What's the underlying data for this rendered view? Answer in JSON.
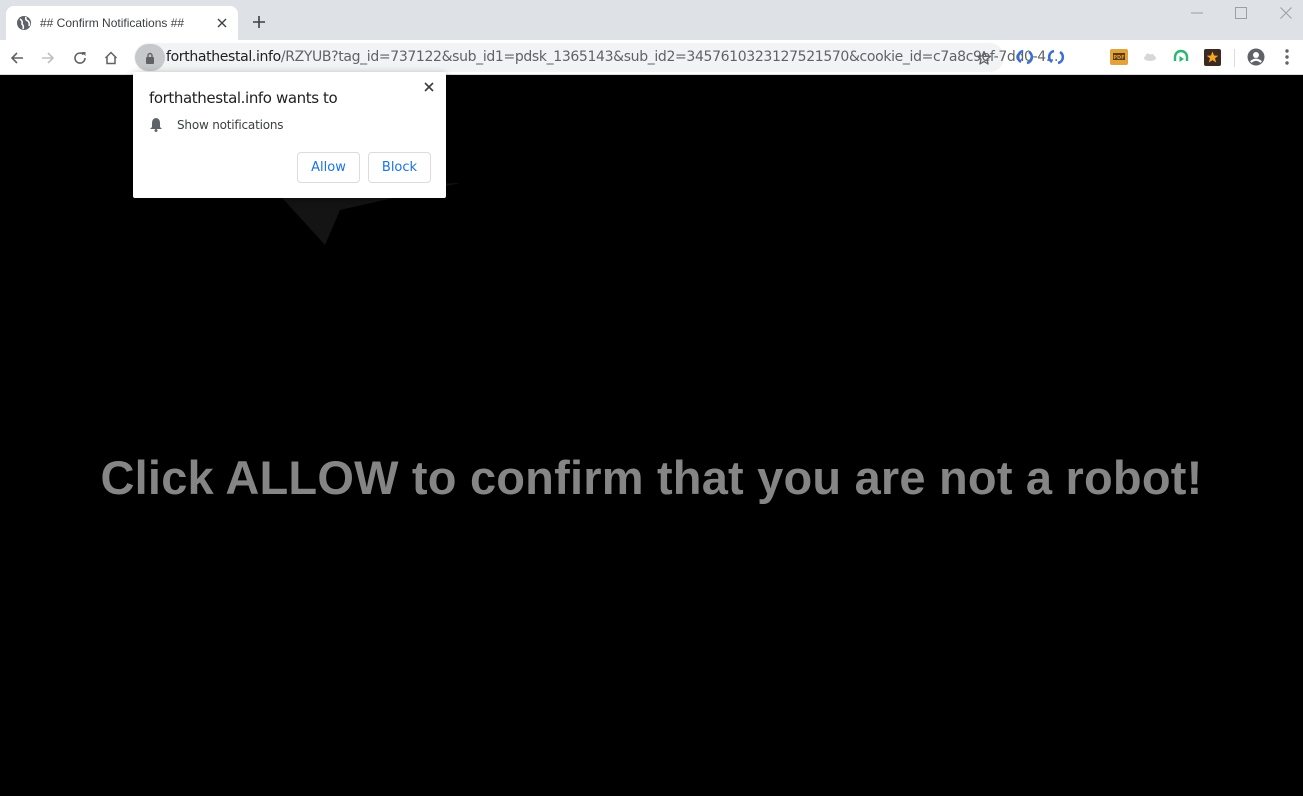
{
  "browser": {
    "tab": {
      "title": "## Confirm Notifications ##",
      "favicon": "globe-icon",
      "close": "close-icon"
    },
    "new_tab_icon": "plus-icon",
    "window_controls": [
      "minimize-icon",
      "maximize-icon",
      "close-icon"
    ],
    "nav": [
      "back-icon",
      "forward-icon",
      "reload-icon",
      "home-icon"
    ],
    "omnibox": {
      "security_icon": "lock-icon",
      "host": "forthathestal.info",
      "path": "/RZYUB?tag_id=737122&sub_id1=pdsk_1365143&sub_id2=3457610323127521570&cookie_id=c7a8c9ef-7dd0-4..."
    },
    "bookmark_icon": "star-icon",
    "extensions": [
      "sync-icon",
      "sync-icon",
      "pdf-icon",
      "cloud-icon",
      "headphones-icon",
      "star-badge-icon"
    ],
    "profile_icon": "account-icon",
    "menu_icon": "more-vert-icon"
  },
  "popup": {
    "title": "forthathestal.info wants to",
    "permission_icon": "bell-icon",
    "permission": "Show notifications",
    "allow_label": "Allow",
    "block_label": "Block"
  },
  "page": {
    "headline": "Click ALLOW to confirm that you are not a robot!"
  },
  "colors": {
    "tabstrip": "#dee1e6",
    "accent_blue": "#1a73e8",
    "headline": "#858585",
    "page_bg": "#000000"
  }
}
